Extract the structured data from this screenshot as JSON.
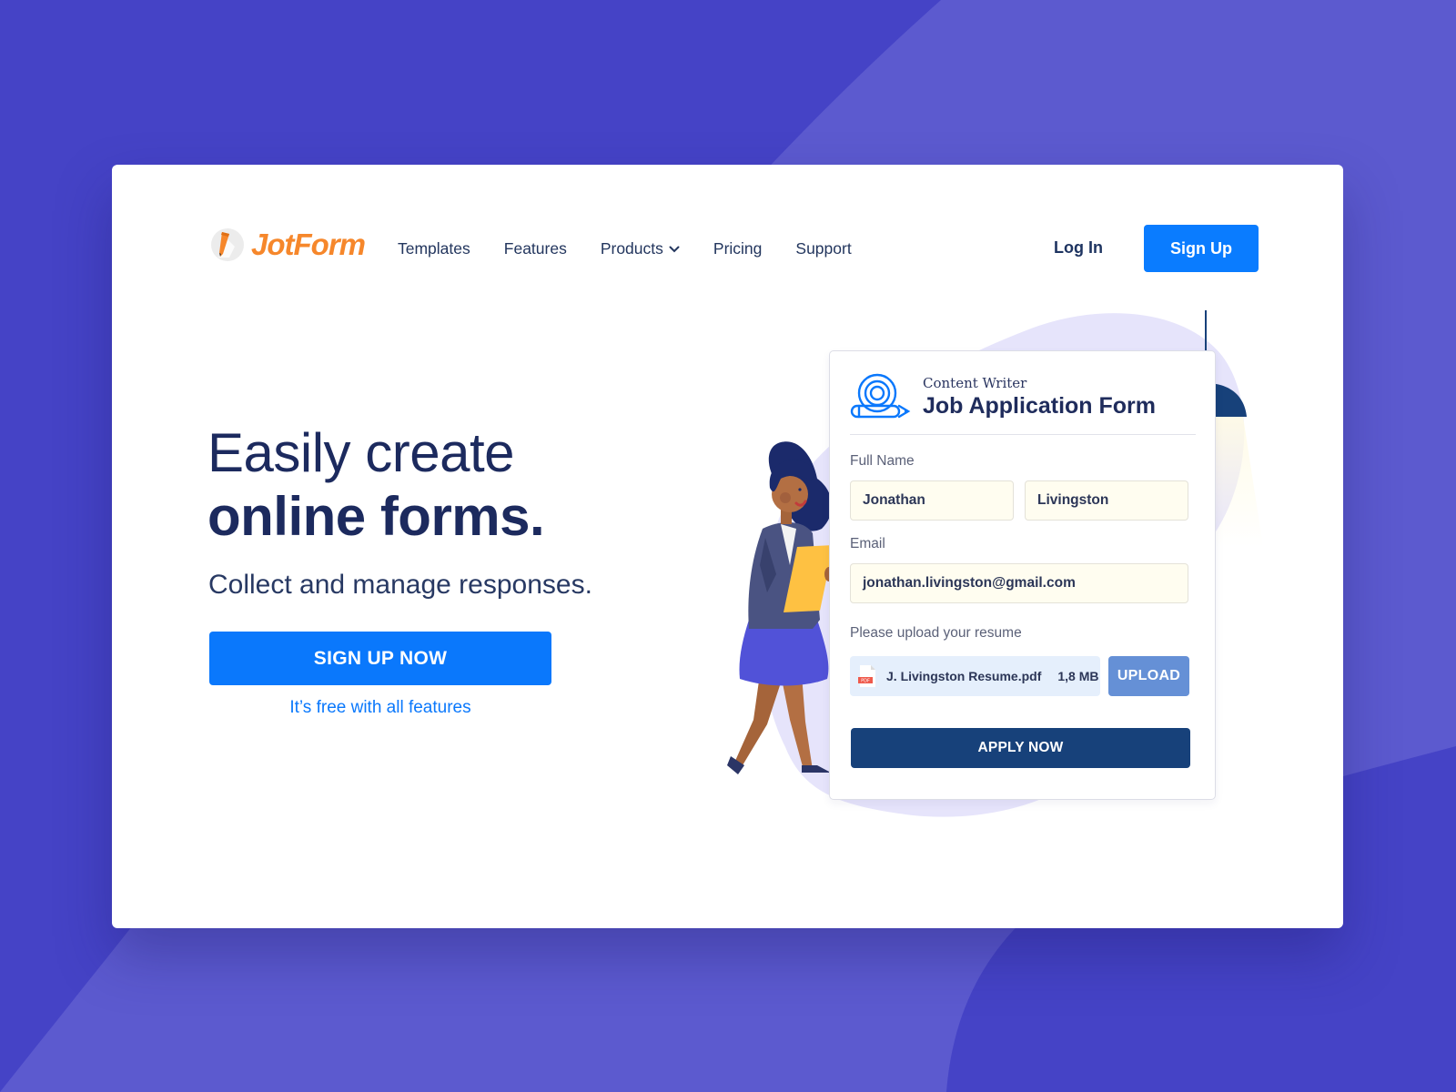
{
  "colors": {
    "background_dark": "#4543c6",
    "background_light": "#5c5acf",
    "brand_orange": "#f6872b",
    "primary_blue": "#0a78fc",
    "navy_text": "#1c2a5e",
    "apply_button": "#17417a",
    "upload_button": "#6590d6",
    "blob_lavender": "#e6e4fb",
    "input_fill": "#fffdf0"
  },
  "header": {
    "logo_text": "JotForm",
    "logo_icon": "pencil-icon",
    "nav": [
      {
        "label": "Templates",
        "has_dropdown": false
      },
      {
        "label": "Features",
        "has_dropdown": false
      },
      {
        "label": "Products",
        "has_dropdown": true
      },
      {
        "label": "Pricing",
        "has_dropdown": false
      },
      {
        "label": "Support",
        "has_dropdown": false
      }
    ],
    "login_label": "Log In",
    "signup_label": "Sign Up"
  },
  "hero": {
    "title_line1": "Easily create",
    "title_line2": "online forms.",
    "subtitle": "Collect and manage responses.",
    "cta_label": "SIGN UP NOW",
    "cta_note": "It’s free with all features"
  },
  "form_preview": {
    "kicker": "Content Writer",
    "title": "Job Application Form",
    "icon": "rolled-paper-pencil-icon",
    "full_name_label": "Full Name",
    "first_name_value": "Jonathan",
    "last_name_value": "Livingston",
    "email_label": "Email",
    "email_value": "jonathan.livingston@gmail.com",
    "upload_label": "Please upload your resume",
    "file_badge": "PDF",
    "file_name": "J. Livingston Resume.pdf",
    "file_size": "1,8 MB",
    "upload_button": "UPLOAD",
    "submit_button": "APPLY NOW"
  }
}
